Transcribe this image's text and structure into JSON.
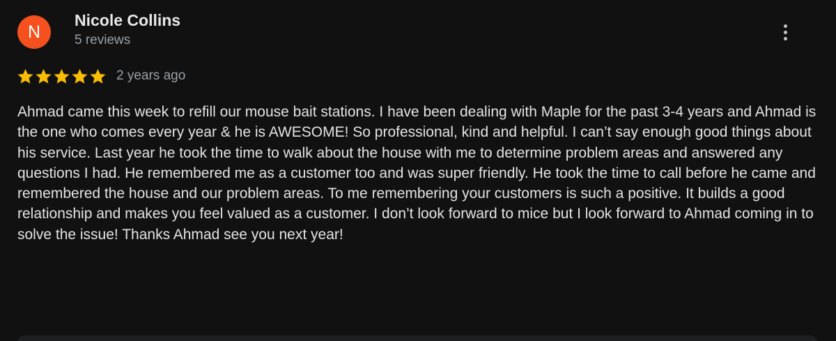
{
  "review": {
    "author_initial": "N",
    "author_name": "Nicole Collins",
    "review_count": "5 reviews",
    "rating": 5,
    "rating_max": 5,
    "date": "2 years ago",
    "text": "Ahmad came this week to refill our mouse bait stations. I have been dealing with Maple for the past 3-4 years and Ahmad is the one who comes every year & he is AWESOME! So professional, kind and helpful. I can’t say enough good things about his service. Last year he took the time to walk about the house with me to determine problem areas and answered any questions I had. He remembered me as a customer too and was super friendly. He took the time to call before he came and remembered the house and our problem areas. To me remembering your customers is such a positive. It builds a good relationship and makes you feel valued as a customer. I don’t look forward to mice but I look forward to Ahmad coming in to solve the issue! Thanks Ahmad see you next year!"
  },
  "icons": {
    "more": "more-vert-icon",
    "star": "star-icon"
  },
  "colors": {
    "background": "#111111",
    "avatar": "#f4511e",
    "star": "#fbbc04",
    "text_primary": "#e3e3e3",
    "text_secondary": "#9aa0a6"
  }
}
